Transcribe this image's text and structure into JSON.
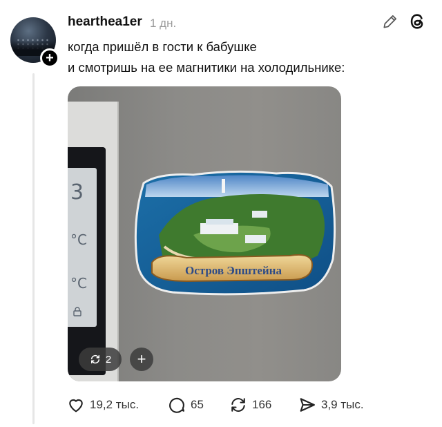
{
  "post": {
    "username": "hearthea1er",
    "timestamp": "1 дн.",
    "text_lines": [
      "когда пришёл в гости к бабушке",
      "и смотришь на ее магнитики на холодильнике:"
    ],
    "image": {
      "magnet_caption": "Остров Эпштейна",
      "fridge_display": [
        "3",
        "°C",
        "°C"
      ],
      "overlay_repost_count": "2",
      "overlay_plus": "+"
    }
  },
  "actions": {
    "likes": "19,2 тыс.",
    "comments": "65",
    "reposts": "166",
    "shares": "3,9 тыс."
  },
  "icons": {
    "avatar_follow": "plus-icon",
    "edit": "pencil-icon",
    "app": "threads-icon",
    "like": "heart-icon",
    "comment": "comment-bubble-icon",
    "repost": "repost-icon",
    "share": "send-icon"
  },
  "colors": {
    "timestamp": "#9a9a9a",
    "action_text": "#333333",
    "thread_line": "#e6e6e6"
  }
}
